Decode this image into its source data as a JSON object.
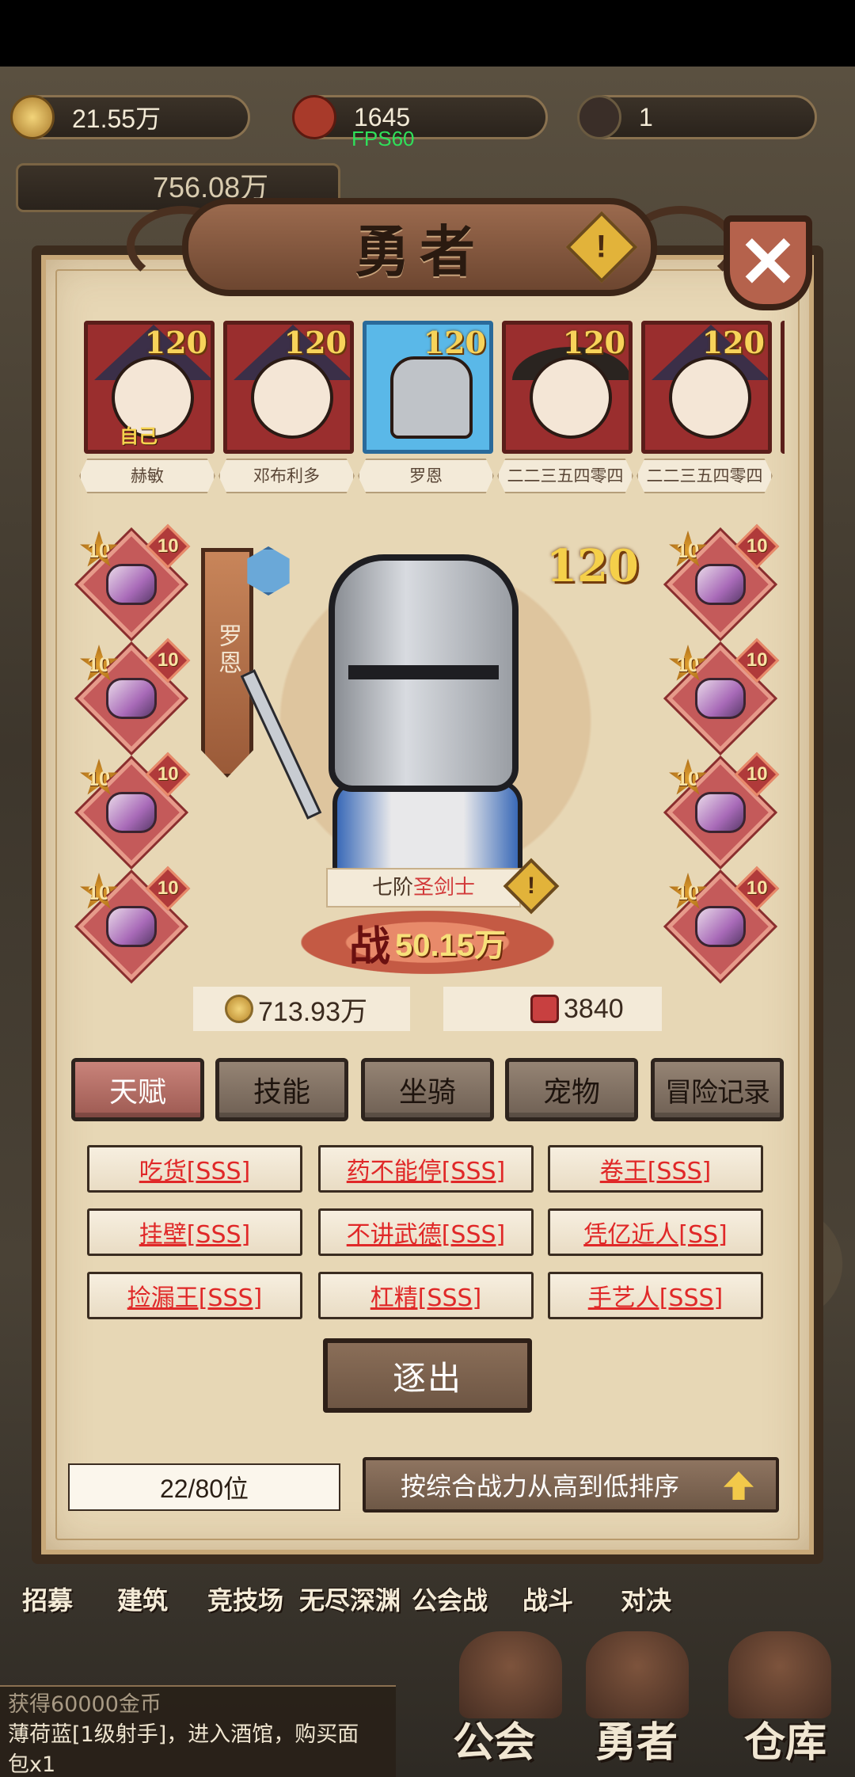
{
  "top_bar": {
    "gold": "21.55万",
    "medals": "1645",
    "gems": "1",
    "fps": "FPS60",
    "power": "756.08万"
  },
  "panel": {
    "title": "勇者",
    "warn_icon": "!",
    "close_icon": "✕"
  },
  "heroes": [
    {
      "level": "120",
      "name": "赫敏",
      "tag": "自己",
      "selected": false
    },
    {
      "level": "120",
      "name": "邓布利多",
      "tag": "",
      "selected": false
    },
    {
      "level": "120",
      "name": "罗恩",
      "tag": "",
      "selected": true
    },
    {
      "level": "120",
      "name": "二二三五四零四",
      "tag": "",
      "selected": false
    },
    {
      "level": "120",
      "name": "二二三五四零四",
      "tag": "",
      "selected": false
    }
  ],
  "equipment": {
    "left": [
      {
        "star": "10",
        "level": "10",
        "icon": "wing-weapon-icon"
      },
      {
        "star": "10",
        "level": "10",
        "icon": "chest-armor-icon"
      },
      {
        "star": "10",
        "level": "10",
        "icon": "helmet-icon"
      },
      {
        "star": "10",
        "level": "10",
        "icon": "boots-icon"
      }
    ],
    "right": [
      {
        "star": "10",
        "level": "10",
        "icon": "necklace-icon"
      },
      {
        "star": "10",
        "level": "10",
        "icon": "ring-icon"
      },
      {
        "star": "10",
        "level": "10",
        "icon": "bracer-icon"
      },
      {
        "star": "10",
        "level": "10",
        "icon": "cloak-icon"
      }
    ]
  },
  "hero": {
    "name": "罗恩",
    "level": "120",
    "class_prefix": "七阶",
    "class_name": "圣剑士",
    "power_label": "战",
    "power": "50.15万"
  },
  "currency": {
    "gold": "713.93万",
    "tokens": "3840"
  },
  "tabs": [
    "天赋",
    "技能",
    "坐骑",
    "宠物",
    "冒险记录"
  ],
  "talents": [
    "吃货[SSS]",
    "药不能停[SSS]",
    "卷王[SSS]",
    "挂壁[SSS]",
    "不讲武德[SSS]",
    "凭亿近人[SS]",
    "捡漏王[SSS]",
    "杠精[SSS]",
    "手艺人[SSS]"
  ],
  "expel_label": "逐出",
  "rank": "22/80位",
  "sort_label": "按综合战力从高到低排序",
  "bottom_nav": [
    "招募",
    "建筑",
    "竞技场",
    "无尽深渊",
    "公会战",
    "战斗",
    "对决"
  ],
  "message": {
    "line1": "获得60000金币",
    "line2": "薄荷蓝[1级射手]，进入酒馆，购买面",
    "line3": "包x1"
  },
  "main_nav": [
    "公会",
    "勇者",
    "仓库"
  ]
}
